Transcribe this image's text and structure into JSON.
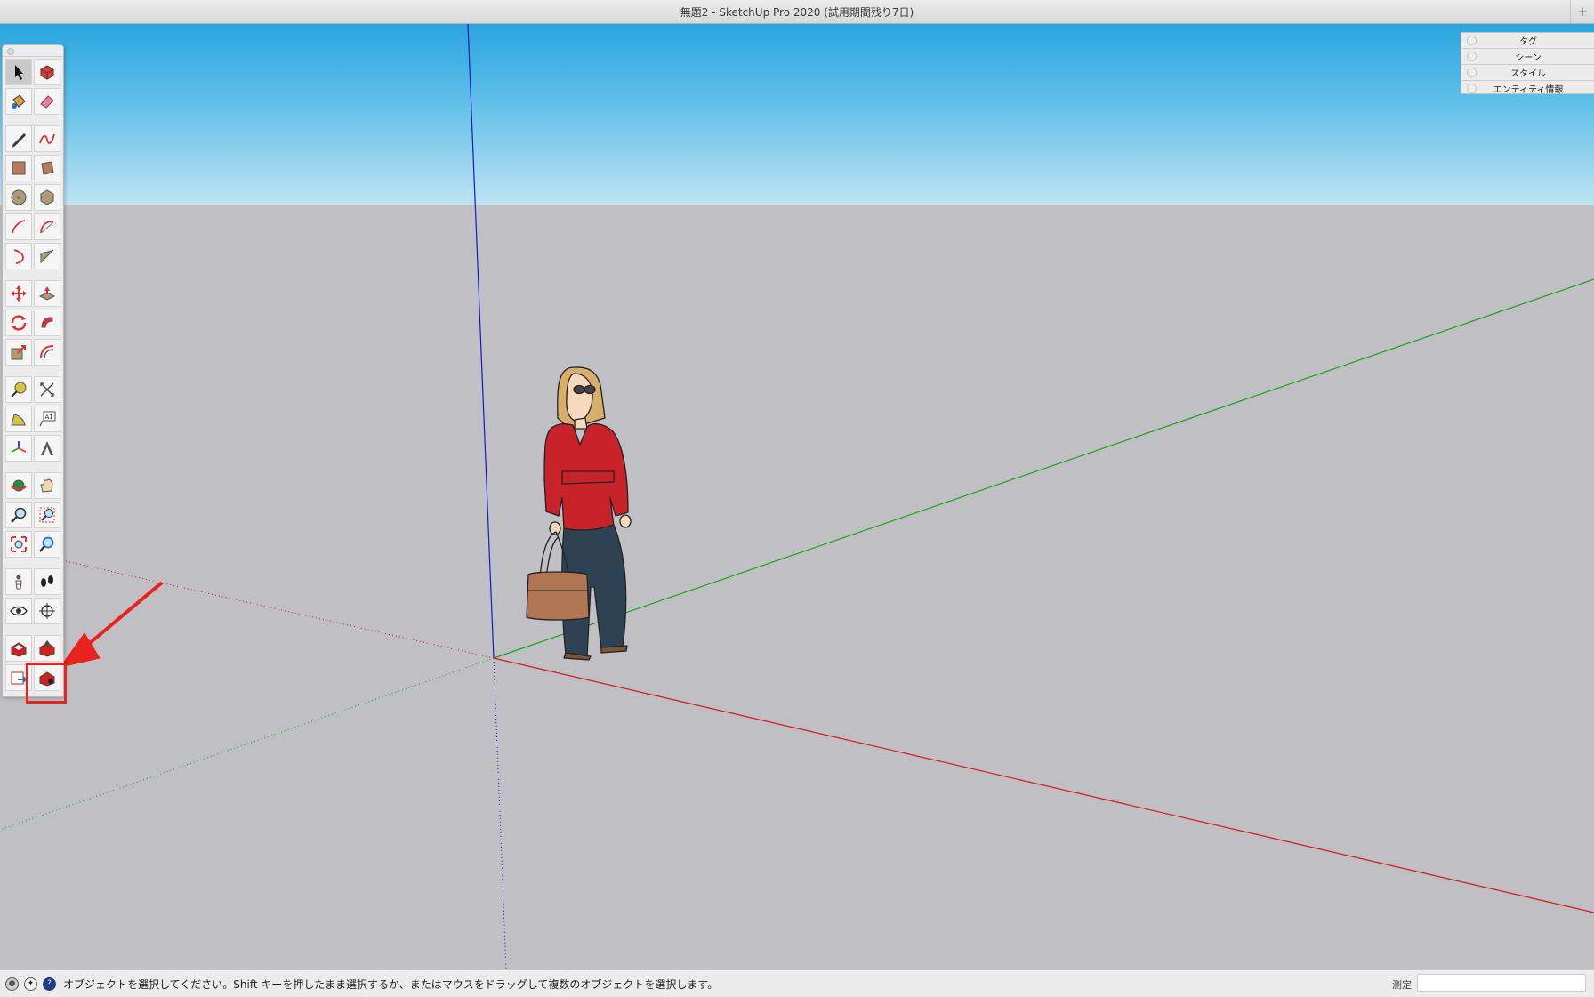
{
  "window": {
    "title": "無題2 - SketchUp Pro 2020 (試用期間残り7日)",
    "add_button": "+"
  },
  "tray": {
    "items": [
      "タグ",
      "シーン",
      "スタイル",
      "エンティティ情報"
    ]
  },
  "toolbar": {
    "tools": [
      {
        "name": "select-tool",
        "icon": "arrow-cursor-icon",
        "active": true
      },
      {
        "name": "make-component-tool",
        "icon": "component-icon"
      },
      {
        "name": "paint-bucket-tool",
        "icon": "paint-bucket-icon"
      },
      {
        "name": "eraser-tool",
        "icon": "eraser-icon"
      },
      {
        "name": "line-tool",
        "icon": "pencil-icon"
      },
      {
        "name": "freehand-tool",
        "icon": "freehand-icon"
      },
      {
        "name": "rectangle-tool",
        "icon": "rectangle-icon"
      },
      {
        "name": "rotated-rectangle-tool",
        "icon": "rotated-rectangle-icon"
      },
      {
        "name": "circle-tool",
        "icon": "circle-icon"
      },
      {
        "name": "polygon-tool",
        "icon": "polygon-icon"
      },
      {
        "name": "arc-tool",
        "icon": "arc-icon"
      },
      {
        "name": "two-point-arc-tool",
        "icon": "two-point-arc-icon"
      },
      {
        "name": "three-point-arc-tool",
        "icon": "three-point-arc-icon"
      },
      {
        "name": "pie-tool",
        "icon": "pie-icon"
      },
      {
        "name": "move-tool",
        "icon": "move-arrows-icon"
      },
      {
        "name": "push-pull-tool",
        "icon": "push-pull-icon"
      },
      {
        "name": "rotate-tool",
        "icon": "rotate-icon"
      },
      {
        "name": "follow-me-tool",
        "icon": "follow-me-icon"
      },
      {
        "name": "scale-tool",
        "icon": "scale-icon"
      },
      {
        "name": "offset-tool",
        "icon": "offset-icon"
      },
      {
        "name": "tape-measure-tool",
        "icon": "tape-measure-icon"
      },
      {
        "name": "dimension-tool",
        "icon": "dimension-icon"
      },
      {
        "name": "protractor-tool",
        "icon": "protractor-icon"
      },
      {
        "name": "text-tool",
        "icon": "text-label-icon",
        "text": "A1"
      },
      {
        "name": "axes-tool",
        "icon": "axes-icon"
      },
      {
        "name": "3d-text-tool",
        "icon": "3d-text-icon"
      },
      {
        "name": "orbit-tool",
        "icon": "orbit-icon"
      },
      {
        "name": "pan-tool",
        "icon": "hand-icon"
      },
      {
        "name": "zoom-tool",
        "icon": "magnifier-icon"
      },
      {
        "name": "zoom-window-tool",
        "icon": "zoom-window-icon"
      },
      {
        "name": "zoom-extents-tool",
        "icon": "zoom-extents-icon"
      },
      {
        "name": "previous-view-tool",
        "icon": "previous-view-icon"
      },
      {
        "name": "position-camera-tool",
        "icon": "position-camera-icon"
      },
      {
        "name": "walk-tool",
        "icon": "footprints-icon"
      },
      {
        "name": "look-around-tool",
        "icon": "eye-icon"
      },
      {
        "name": "section-plane-tool",
        "icon": "section-plane-icon"
      },
      {
        "name": "3d-warehouse-tool",
        "icon": "warehouse-icon"
      },
      {
        "name": "share-model-tool",
        "icon": "share-model-icon"
      },
      {
        "name": "send-to-layout-tool",
        "icon": "send-to-layout-icon"
      },
      {
        "name": "extension-warehouse-tool",
        "icon": "extension-warehouse-icon"
      }
    ]
  },
  "status": {
    "icons": [
      "geo-location-icon",
      "credits-icon",
      "help-icon"
    ],
    "message": "オブジェクトを選択してください。Shift キーを押したまま選択するか、またはマウスをドラッグして複数のオブジェクトを選択します。",
    "measure_label": "測定",
    "measure_value": ""
  },
  "colors": {
    "red_axis": "#d11a1a",
    "green_axis": "#16a616",
    "blue_axis": "#1818c8",
    "annotation": "#e8231d",
    "sky_top": "#2aa5df",
    "ground": "#c0bfc4"
  }
}
